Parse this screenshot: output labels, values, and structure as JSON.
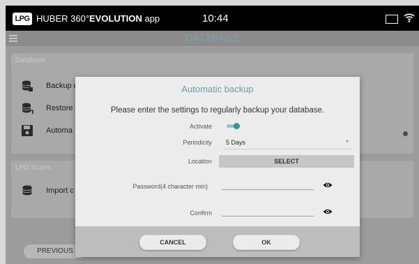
{
  "status_bar": {
    "logo_text": "LPG",
    "app_name_prefix": "HUBER 360",
    "app_name_degree": "°",
    "app_name_bold": "EVOLUTION",
    "app_name_suffix": " app",
    "time": "10:44",
    "icons": [
      "window-square-icon",
      "wifi-icon"
    ]
  },
  "header": {
    "menu_icon": "hamburger-menu-icon",
    "title": "DATABASE"
  },
  "database_card": {
    "heading": "Database",
    "items": [
      {
        "icon": "database-backup-icon",
        "label": "Backup d"
      },
      {
        "icon": "database-restore-icon",
        "label": "Restore"
      },
      {
        "icon": "floppy-disk-icon",
        "label": "Automa"
      }
    ]
  },
  "scan_card": {
    "heading": "LPG Scans",
    "items": [
      {
        "icon": "database-import-icon",
        "label": "Import c"
      }
    ]
  },
  "previous_label": "PREVIOUS",
  "dialog": {
    "title": "Automatic backup",
    "message": "Please enter the settings to regularly backup your database.",
    "activate_label": "Activate",
    "activate_on": true,
    "periodicity_label": "Periodicity",
    "periodicity_value": "5 Days",
    "location_label": "Location",
    "location_button": "SELECT",
    "password_label": "Password(4 character min)",
    "password_value": "",
    "confirm_label": "Confirm",
    "confirm_value": "",
    "cancel_label": "CANCEL",
    "ok_label": "OK"
  },
  "colors": {
    "accent": "#6e9aa4",
    "toggle": "#3e8c96",
    "overlay_bg": "#9c9c9c",
    "dialog_bg": "#ececec"
  }
}
